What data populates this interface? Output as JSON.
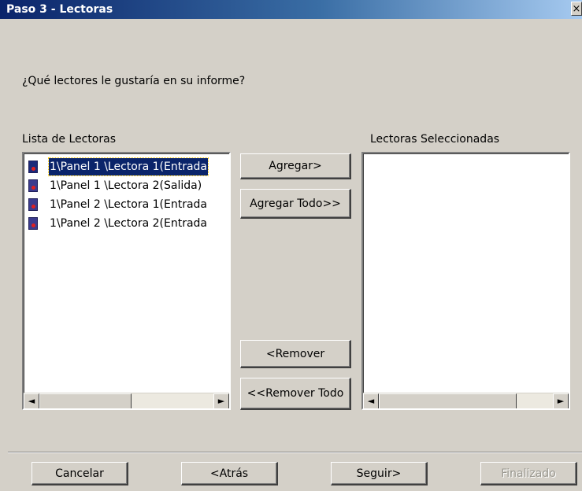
{
  "window": {
    "title": "Paso 3 - Lectoras",
    "close_glyph": "×"
  },
  "question": "¿Qué lectores le gustaría en su informe?",
  "available": {
    "label": "Lista de Lectoras",
    "items": [
      {
        "label": "1\\Panel 1 \\Lectora 1(Entrada",
        "selected": true,
        "icon": "reader-icon"
      },
      {
        "label": "1\\Panel 1 \\Lectora 2(Salida)",
        "selected": false,
        "icon": "reader-icon"
      },
      {
        "label": "1\\Panel 2 \\Lectora 1(Entrada",
        "selected": false,
        "icon": "reader-icon"
      },
      {
        "label": "1\\Panel 2 \\Lectora 2(Entrada",
        "selected": false,
        "icon": "reader-icon"
      }
    ]
  },
  "selected_list": {
    "label": "Lectoras Seleccionadas",
    "items": []
  },
  "transfer": {
    "add": "Agregar>",
    "add_all": "Agregar Todo>>",
    "remove": "<Remover",
    "remove_all": "<<Remover Todo"
  },
  "footer": {
    "cancel": "Cancelar",
    "back": "<Atrás",
    "next": "Seguir>",
    "finish": "Finalizado"
  },
  "scroll_arrows": {
    "left": "◄",
    "right": "►"
  }
}
